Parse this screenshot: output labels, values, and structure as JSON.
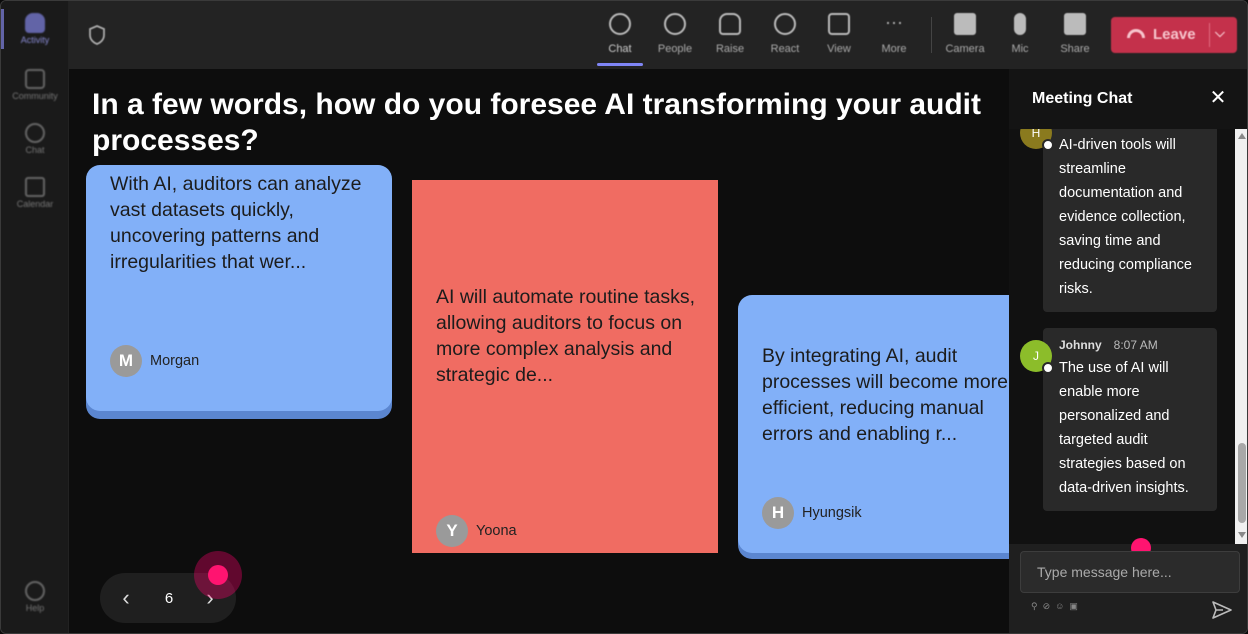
{
  "rail": {
    "items": [
      {
        "label": "Activity"
      },
      {
        "label": "Community"
      },
      {
        "label": "Chat"
      },
      {
        "label": "Calendar"
      },
      {
        "label": "Help"
      }
    ]
  },
  "toolbar": {
    "chat": "Chat",
    "people": "People",
    "raise": "Raise",
    "react": "React",
    "view": "View",
    "more": "More",
    "camera": "Camera",
    "mic": "Mic",
    "share": "Share",
    "leave": "Leave"
  },
  "stage": {
    "question": "In a few words, how do you foresee AI transforming your audit processes?",
    "cards": [
      {
        "text": "With AI, auditors can analyze vast datasets quickly, uncovering patterns and irregularities that wer...",
        "initial": "M",
        "author": "Morgan",
        "color": "#82b0f8"
      },
      {
        "text": "AI will automate routine tasks, allowing auditors to focus on more complex analysis and strategic de...",
        "initial": "Y",
        "author": "Yoona",
        "color": "#f06c62"
      },
      {
        "text": "By integrating AI, audit processes will become more efficient, reducing manual errors and enabling r...",
        "initial": "H",
        "author": "Hyungsik",
        "color": "#82b0f8"
      }
    ],
    "pager": {
      "page": "6"
    }
  },
  "chat": {
    "title": "Meeting Chat",
    "messages": [
      {
        "avatar": "H",
        "avatar_color": "#8a7a1e",
        "text": "AI-driven tools will streamline documentation and evidence collection, saving time and reducing compliance risks."
      },
      {
        "avatar": "J",
        "avatar_color": "#8cbd2a",
        "sender": "Johnny",
        "time": "8:07 AM",
        "text": "The use of AI will enable more personalized and targeted audit strategies based on data-driven insights."
      }
    ],
    "input_placeholder": "Type message here..."
  }
}
